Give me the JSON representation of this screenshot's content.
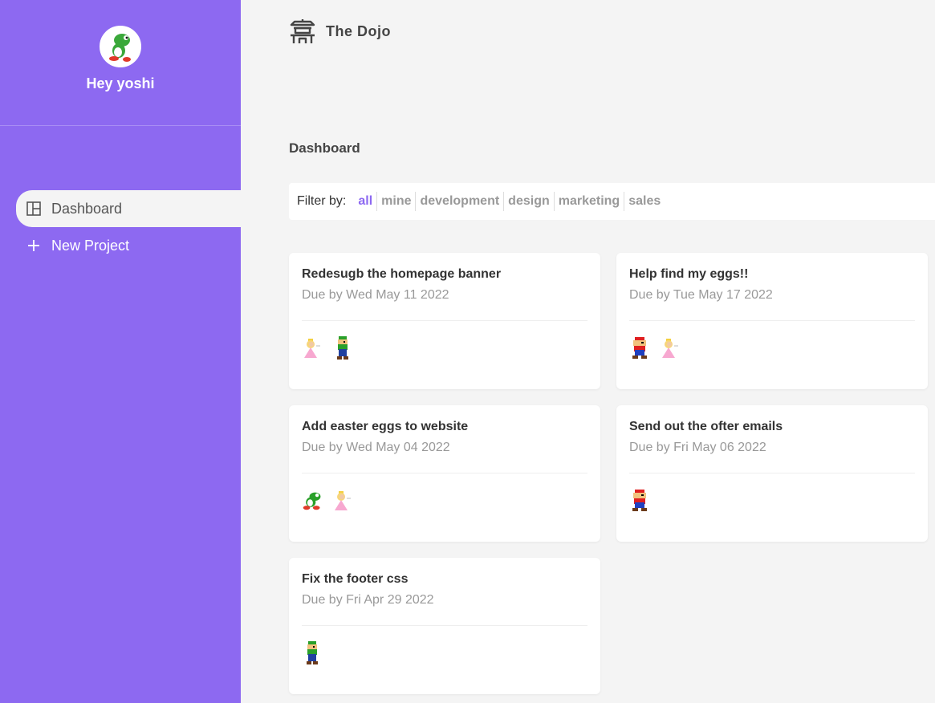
{
  "sidebar": {
    "user_name": "Hey yoshi",
    "nav": [
      {
        "label": "Dashboard",
        "icon": "dashboard-icon",
        "active": true
      },
      {
        "label": "New Project",
        "icon": "plus-icon",
        "active": false
      }
    ]
  },
  "header": {
    "brand": "The Dojo",
    "icon": "temple-icon"
  },
  "page": {
    "title": "Dashboard"
  },
  "filter": {
    "label": "Filter by:",
    "options": [
      "all",
      "mine",
      "development",
      "design",
      "marketing",
      "sales"
    ],
    "active": "all"
  },
  "projects": [
    {
      "title": "Redesugb the homepage banner",
      "due": "Due by Wed May 11 2022",
      "assignees": [
        "peach",
        "luigi"
      ]
    },
    {
      "title": "Help find my eggs!!",
      "due": "Due by Tue May 17 2022",
      "assignees": [
        "mario",
        "peach"
      ]
    },
    {
      "title": "Add easter eggs to website",
      "due": "Due by Wed May 04 2022",
      "assignees": [
        "yoshi",
        "peach"
      ]
    },
    {
      "title": "Send out the ofter emails",
      "due": "Due by Fri May 06 2022",
      "assignees": [
        "mario"
      ]
    },
    {
      "title": "Fix the footer css",
      "due": "Due by Fri Apr 29 2022",
      "assignees": [
        "luigi"
      ]
    }
  ],
  "colors": {
    "accent": "#8d69f1",
    "background": "#f4f4f4"
  }
}
